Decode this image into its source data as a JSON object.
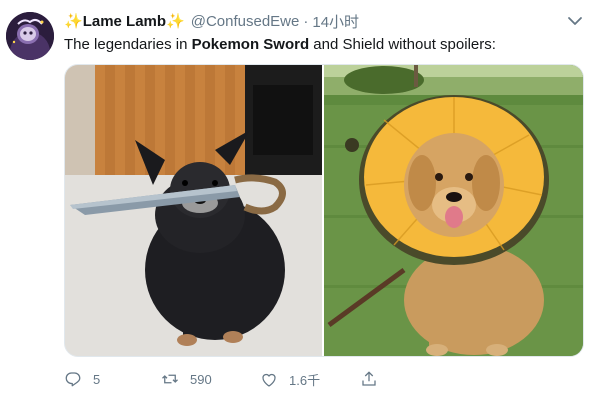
{
  "tweet": {
    "display_name": "Lame Lamb",
    "display_name_emoji_left": "✨",
    "display_name_emoji_right": "✨",
    "handle": "@ConfusedEwe",
    "separator": "·",
    "timestamp": "14小时",
    "text_before": "The legendaries in ",
    "text_bold": "Pokemon Sword",
    "text_after": " and Shield without spoilers:"
  },
  "actions": {
    "reply_count": "5",
    "retweet_count": "590",
    "like_count": "1.6千"
  },
  "icons": {
    "reply": "reply-icon",
    "retweet": "retweet-icon",
    "like": "heart-icon",
    "share": "share-icon",
    "menu": "chevron-down-icon"
  },
  "colors": {
    "text": "#14171a",
    "secondary": "#657786",
    "sparkle": "#f7b500",
    "cone_yellow": "#f5b93b"
  }
}
